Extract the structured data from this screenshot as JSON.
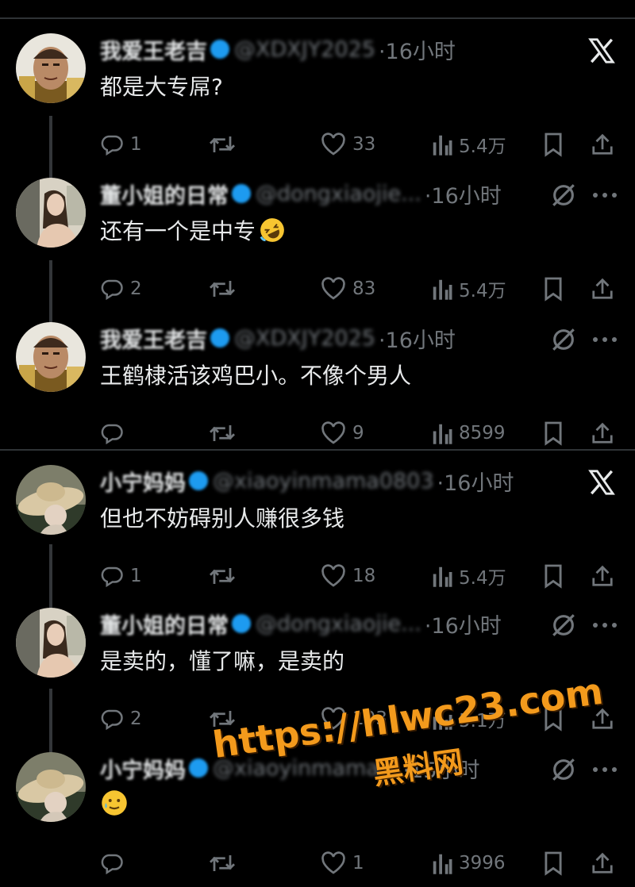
{
  "tweets": [
    {
      "name": "我爱王老吉",
      "handle": "@XDXJY2025",
      "time": "·16小时",
      "text": "都是大专屌?",
      "emoji": "",
      "corner": "x-logo",
      "avatar": "monk",
      "replies": "1",
      "likes": "33",
      "views": "5.4万"
    },
    {
      "name": "董小姐的日常",
      "handle": "@dongxiaojie...",
      "time": "·16小时",
      "text": "还有一个是中专",
      "emoji": "rofl",
      "corner": "grok",
      "avatar": "woman",
      "replies": "2",
      "likes": "83",
      "views": "5.4万"
    },
    {
      "name": "我爱王老吉",
      "handle": "@XDXJY2025",
      "time": "·16小时",
      "text": "王鹤棣活该鸡巴小。不像个男人",
      "emoji": "",
      "corner": "grok",
      "avatar": "monk",
      "replies": "",
      "likes": "9",
      "views": "8599"
    },
    {
      "name": "小宁妈妈",
      "handle": "@xiaoyinmama0803",
      "time": "·16小时",
      "text": "但也不妨碍别人赚很多钱",
      "emoji": "",
      "corner": "x-logo",
      "avatar": "hat",
      "replies": "1",
      "likes": "18",
      "views": "5.4万"
    },
    {
      "name": "董小姐的日常",
      "handle": "@dongxiaojie...",
      "time": "·16小时",
      "text": "是卖的，懂了嘛，是卖的",
      "emoji": "",
      "corner": "grok",
      "avatar": "woman",
      "replies": "2",
      "likes": "103",
      "views": "5.1万"
    },
    {
      "name": "小宁妈妈",
      "handle": "@xiaoyinmama...",
      "time": "·15小时",
      "text": "",
      "emoji": "smile-tear",
      "corner": "grok",
      "avatar": "hat",
      "replies": "",
      "likes": "1",
      "views": "3996"
    }
  ],
  "watermark": {
    "line1": "https://hlwc23.com",
    "line2": "黑料网"
  },
  "colors": {
    "background": "#000000",
    "text": "#e7e9ea",
    "muted": "#71767b",
    "separator": "#2f3336",
    "verified": "#1d9bf0",
    "watermark": "#f39a1c"
  }
}
